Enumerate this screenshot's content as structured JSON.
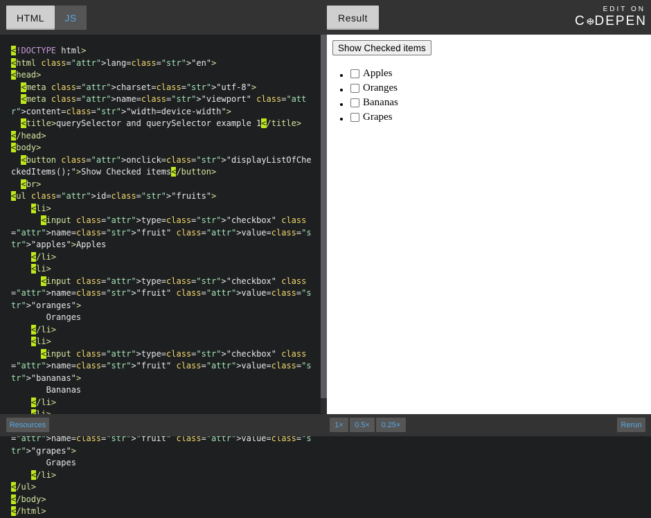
{
  "editor": {
    "tabs": [
      {
        "label": "HTML",
        "active": true
      },
      {
        "label": "JS",
        "active": false
      }
    ]
  },
  "result": {
    "tab_label": "Result",
    "button_label": "Show Checked items",
    "list_items": [
      "Apples",
      "Oranges",
      "Bananas",
      "Grapes"
    ]
  },
  "branding": {
    "edit_on": "EDIT ON",
    "brand_left": "C",
    "brand_right": "DEPEN"
  },
  "code_lines": [
    "<!DOCTYPE html>",
    "<html lang=\"en\">",
    "<head>",
    "  <meta charset=\"utf-8\">",
    "  <meta name=\"viewport\" content=\"width=device-width\">",
    "  <title>querySelector and querySelector example 1</title>",
    "</head>",
    "<body>",
    "  <button onclick=\"displayListOfCheckedItems();\">Show Checked items</button>",
    "  <br>",
    "<ul id=\"fruits\">",
    "    <li>",
    "      <input type=\"checkbox\" name=\"fruit\" value=\"apples\">Apples",
    "    </li>",
    "    <li>",
    "      <input type=\"checkbox\" name=\"fruit\" value=\"oranges\">",
    "       Oranges",
    "    </li>",
    "    <li>",
    "      <input type=\"checkbox\" name=\"fruit\" value=\"bananas\">",
    "       Bananas",
    "    </li>",
    "    <li>",
    "      <input type=\"checkbox\" name=\"fruit\" value=\"grapes\">",
    "       Grapes",
    "    </li>",
    "</ul>",
    "</body>",
    "</html>"
  ],
  "bottom_bar": {
    "resources_label": "Resources",
    "zoom_options": [
      "1×",
      "0.5×",
      "0.25×"
    ],
    "rerun_label": "Rerun"
  },
  "colors": {
    "accent_blue": "#5aa7e0",
    "highlight_green": "#bfe81c",
    "bar_background": "#333333",
    "editor_background": "#1d1f20"
  }
}
